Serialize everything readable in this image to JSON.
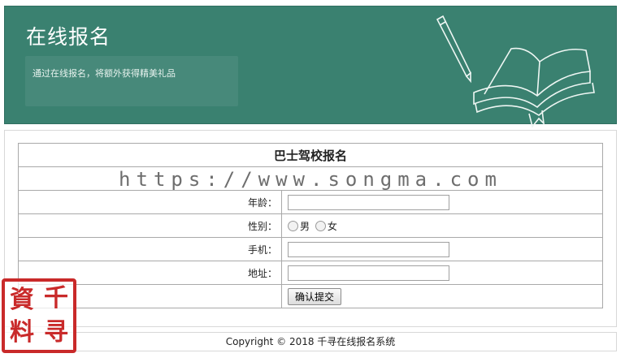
{
  "banner": {
    "title": "在线报名",
    "subtitle": "通过在线报名，将额外获得精美礼品"
  },
  "form": {
    "title": "巴士驾校报名",
    "watermark": "https://www.songma.com",
    "rows": [
      {
        "label": "年龄：",
        "value": ""
      },
      {
        "label": "性别：",
        "options": [
          "男",
          "女"
        ]
      },
      {
        "label": "手机：",
        "value": ""
      },
      {
        "label": "地址：",
        "value": ""
      }
    ],
    "submit_label": "确认提交"
  },
  "footer": {
    "copyright": "Copyright © 2018 千寻在线报名系统"
  },
  "seal": {
    "chars": [
      "資",
      "千",
      "料",
      "寻"
    ],
    "color": "#c92a2a"
  },
  "colors": {
    "banner_bg": "#3a8170",
    "banner_text": "#ffffff"
  }
}
